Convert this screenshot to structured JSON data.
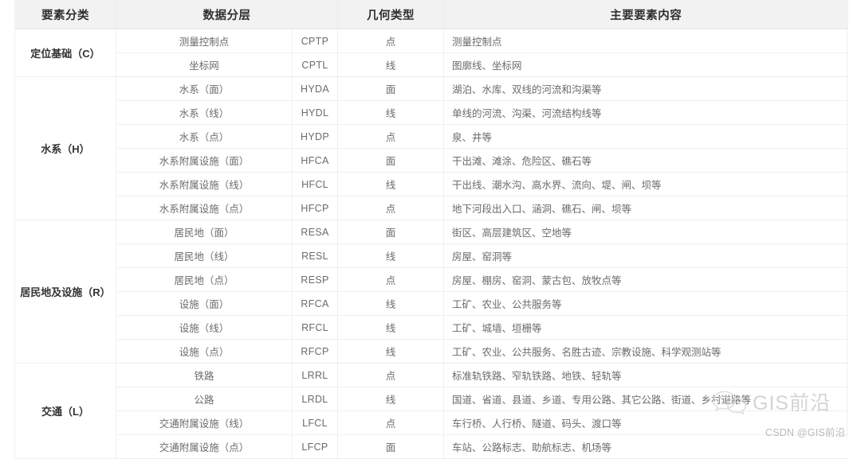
{
  "table": {
    "headers": [
      {
        "label": "要素分类",
        "name": "header-feature-class"
      },
      {
        "label": "数据分层",
        "name": "header-data-layer"
      },
      {
        "label": "几何类型",
        "name": "header-geometry-type"
      },
      {
        "label": "主要要素内容",
        "name": "header-main-content"
      }
    ],
    "groups": [
      {
        "class_label": "定位基础（C）",
        "rows": [
          {
            "layer": "测量控制点",
            "code": "CPTP",
            "geometry": "点",
            "content": "测量控制点"
          },
          {
            "layer": "坐标网",
            "code": "CPTL",
            "geometry": "线",
            "content": "图廓线、坐标网"
          }
        ]
      },
      {
        "class_label": "水系（H）",
        "rows": [
          {
            "layer": "水系（面）",
            "code": "HYDA",
            "geometry": "面",
            "content": "湖泊、水库、双线的河流和沟渠等"
          },
          {
            "layer": "水系（线）",
            "code": "HYDL",
            "geometry": "线",
            "content": "单线的河流、沟渠、河流结构线等"
          },
          {
            "layer": "水系（点）",
            "code": "HYDP",
            "geometry": "点",
            "content": "泉、井等"
          },
          {
            "layer": "水系附属设施（面）",
            "code": "HFCA",
            "geometry": "面",
            "content": "干出滩、滩涂、危险区、礁石等"
          },
          {
            "layer": "水系附属设施（线）",
            "code": "HFCL",
            "geometry": "线",
            "content": "干出线、潮水沟、高水界、流向、堤、闸、坝等"
          },
          {
            "layer": "水系附属设施（点）",
            "code": "HFCP",
            "geometry": "点",
            "content": "地下河段出入口、涵洞、礁石、闸、坝等"
          }
        ]
      },
      {
        "class_label": "居民地及设施（R）",
        "rows": [
          {
            "layer": "居民地（面）",
            "code": "RESA",
            "geometry": "面",
            "content": "街区、高层建筑区、空地等"
          },
          {
            "layer": "居民地（线）",
            "code": "RESL",
            "geometry": "线",
            "content": "房屋、窑洞等"
          },
          {
            "layer": "居民地（点）",
            "code": "RESP",
            "geometry": "点",
            "content": "房屋、棚房、窑洞、蒙古包、放牧点等"
          },
          {
            "layer": "设施（面）",
            "code": "RFCA",
            "geometry": "线",
            "content": "工矿、农业、公共服务等"
          },
          {
            "layer": "设施（线）",
            "code": "RFCL",
            "geometry": "线",
            "content": "工矿、城墙、垣栅等"
          },
          {
            "layer": "设施（点）",
            "code": "RFCP",
            "geometry": "线",
            "content": "工矿、农业、公共服务、名胜古迹、宗教设施、科学观测站等"
          }
        ]
      },
      {
        "class_label": "交通（L）",
        "rows": [
          {
            "layer": "铁路",
            "code": "LRRL",
            "geometry": "点",
            "content": "标准轨铁路、窄轨铁路、地铁、轻轨等"
          },
          {
            "layer": "公路",
            "code": "LRDL",
            "geometry": "线",
            "content": "国道、省道、县道、乡道、专用公路、其它公路、街道、乡村道路等"
          },
          {
            "layer": "交通附属设施（线）",
            "code": "LFCL",
            "geometry": "点",
            "content": "车行桥、人行桥、隧道、码头、渡口等"
          },
          {
            "layer": "交通附属设施（点）",
            "code": "LFCP",
            "geometry": "面",
            "content": "车站、公路标志、助航标志、机场等"
          }
        ]
      }
    ]
  },
  "watermark": {
    "icon": "wechat-icon",
    "text": "GIS前沿"
  },
  "credit": {
    "text": "CSDN @GIS前沿"
  },
  "colors": {
    "header_bg": "#f2f2f2",
    "header_text": "#2f2f2f",
    "body_text": "#6b6b6b",
    "group_text": "#333333",
    "border": "#f0f0f0",
    "watermark": "#d4d4d4",
    "credit": "#b9b9b9"
  }
}
